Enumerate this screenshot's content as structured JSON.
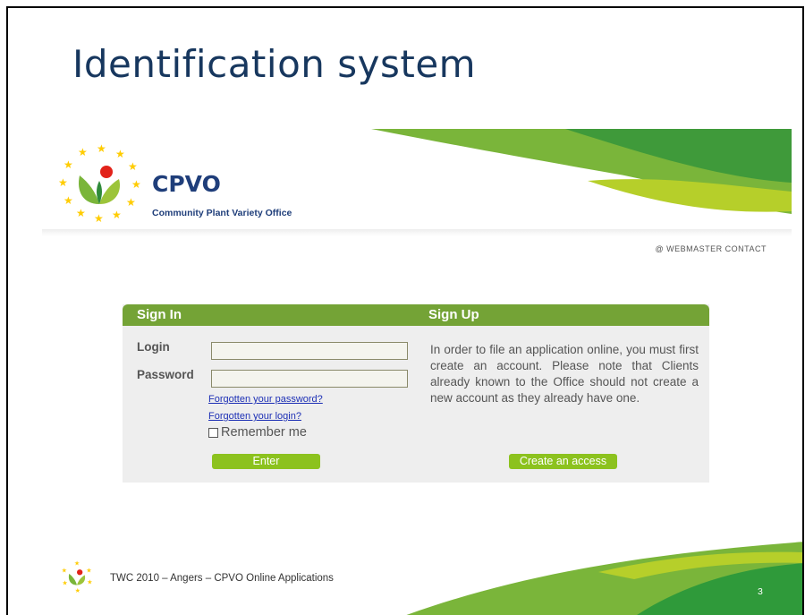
{
  "slide": {
    "title": "Identification system",
    "footer_text": "TWC 2010 – Angers – CPVO Online Applications",
    "page_number": "3"
  },
  "header": {
    "logo_name": "CPVO",
    "logo_subtitle": "Community Plant Variety Office",
    "webmaster_link": "@ WEBMASTER CONTACT"
  },
  "signin": {
    "heading": "Sign In",
    "login_label": "Login",
    "password_label": "Password",
    "login_value": "",
    "password_value": "",
    "forgot_password": "Forgotten your password?",
    "forgot_login": "Forgotten your login?",
    "remember_me": "Remember me",
    "remember_checked": false,
    "enter_button": "Enter"
  },
  "signup": {
    "heading": "Sign Up",
    "text": "In order to file an application online, you must first create an account. Please note that Clients already known to the Office should not create a new account as they already have one.",
    "create_button": "Create an access"
  },
  "colors": {
    "title": "#17375e",
    "accent_green": "#74a336",
    "button_green": "#8cc21e",
    "logo_blue": "#1f3e7a",
    "link_blue": "#1c2fb5"
  },
  "icons": [
    "cpvo-logo-icon",
    "eu-star-ring-icon",
    "checkbox-icon"
  ]
}
